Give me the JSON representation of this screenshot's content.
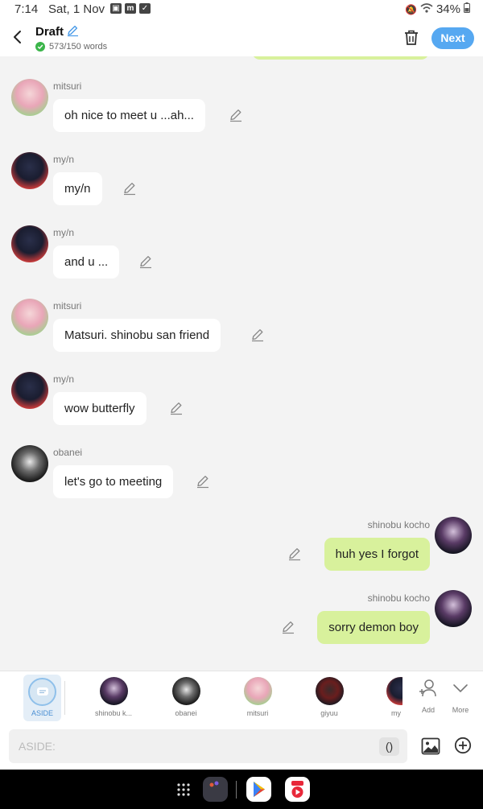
{
  "status_bar": {
    "time": "7:14",
    "date": "Sat, 1 Nov",
    "notif_icons": [
      "gallery-icon",
      "m-icon",
      "check-icon"
    ],
    "m_glyph": "m",
    "battery": "34%"
  },
  "header": {
    "title": "Draft",
    "word_count": "573/150 words",
    "next_label": "Next"
  },
  "messages": [
    {
      "sender": "mitsuri",
      "text": "oh nice to meet u ...ah...",
      "side": "left"
    },
    {
      "sender": "my/n",
      "text": "my/n",
      "side": "left"
    },
    {
      "sender": "my/n",
      "text": "and u ...",
      "side": "left"
    },
    {
      "sender": "mitsuri",
      "text": "Matsuri. shinobu san  friend",
      "side": "left"
    },
    {
      "sender": "my/n",
      "text": "wow butterfly",
      "side": "left"
    },
    {
      "sender": "obanei",
      "text": "let's go to meeting",
      "side": "left"
    },
    {
      "sender": "shinobu kocho",
      "text": "huh yes I forgot",
      "side": "right"
    },
    {
      "sender": "shinobu kocho",
      "text": "sorry demon boy",
      "side": "right"
    }
  ],
  "character_bar": {
    "aside_label": "ASIDE",
    "characters": [
      "shinobu k...",
      "obanei",
      "mitsuri",
      "giyuu",
      "my"
    ],
    "add_label": "Add",
    "more_label": "More"
  },
  "input": {
    "placeholder": "ASIDE:",
    "paren_label": "()"
  },
  "colors": {
    "accent": "#56a8f1",
    "right_bubble": "#d8f19c",
    "left_bubble": "#ffffff",
    "background": "#f3f3f3"
  }
}
